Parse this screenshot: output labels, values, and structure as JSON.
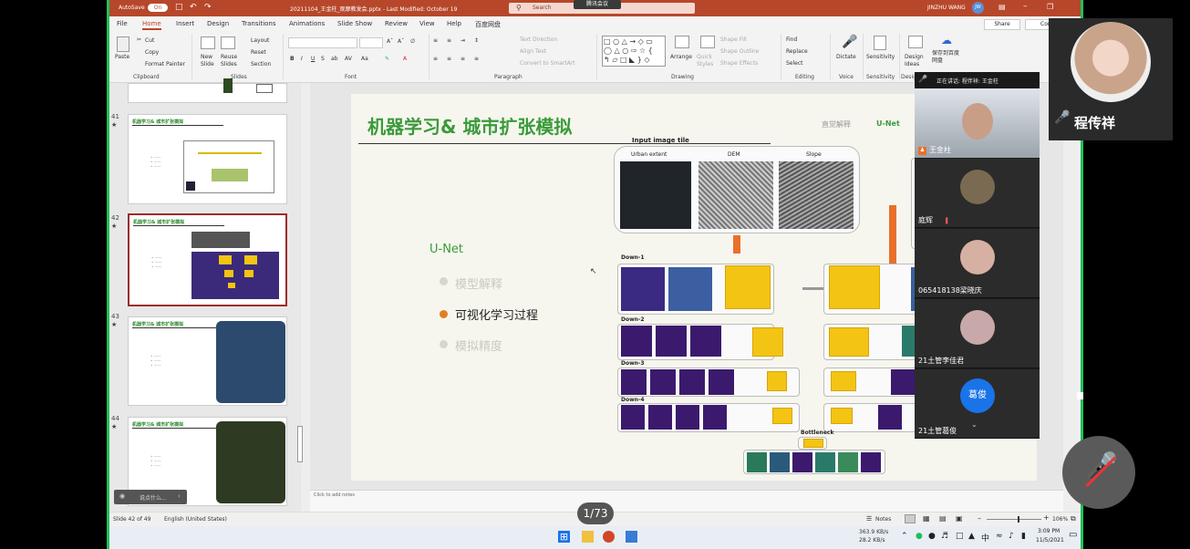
{
  "titlebar": {
    "autosave_label": "AutoSave",
    "autosave_state": "On",
    "filename": "20211104_王金柱_观摩教发会.pptx - Last Modified: October 19",
    "search_placeholder": "Search",
    "meeting_badge": "腾讯会议",
    "user": "JINZHU WANG",
    "user_initials": "JW",
    "share_label": "Share",
    "comments_label": "Con"
  },
  "tabs": [
    "File",
    "Home",
    "Insert",
    "Design",
    "Transitions",
    "Animations",
    "Slide Show",
    "Review",
    "View",
    "Help",
    "百度网盘"
  ],
  "ribbon": {
    "clipboard": {
      "paste": "Paste",
      "cut": "Cut",
      "copy": "Copy",
      "format_painter": "Format Painter",
      "label": "Clipboard"
    },
    "slides": {
      "new": "New Slide",
      "reuse": "Reuse Slides",
      "layout": "Layout",
      "reset": "Reset",
      "section": "Section",
      "label": "Slides"
    },
    "font": {
      "label": "Font",
      "buttons": [
        "B",
        "I",
        "U",
        "S",
        "ab",
        "AV",
        "Aa"
      ]
    },
    "paragraph": {
      "label": "Paragraph",
      "text_direction": "Text Direction",
      "align_text": "Align Text",
      "smartart": "Convert to SmartArt"
    },
    "drawing": {
      "label": "Drawing",
      "arrange": "Arrange",
      "quick_styles": "Quick Styles",
      "shape_fill": "Shape Fill",
      "shape_outline": "Shape Outline",
      "shape_effects": "Shape Effects"
    },
    "editing": {
      "label": "Editing",
      "find": "Find",
      "replace": "Replace",
      "select": "Select"
    },
    "voice": {
      "label": "Voice",
      "dictate": "Dictate"
    },
    "sensitivity": {
      "label": "Sensitivity",
      "button": "Sensitivity"
    },
    "designer": {
      "label": "Desig",
      "button": "Design Ideas"
    },
    "baidu": {
      "button": "保存到百度网盘"
    }
  },
  "thumbnails": [
    {
      "num": "41",
      "title": "机器学习& 城市扩张模拟"
    },
    {
      "num": "42",
      "title": "机器学习& 城市扩张模拟"
    },
    {
      "num": "43",
      "title": "机器学习& 城市扩张模拟"
    },
    {
      "num": "44",
      "title": "机器学习& 城市扩张模拟"
    }
  ],
  "slide": {
    "title": "机器学习& 城市扩张模拟",
    "nav_right": [
      "直觉解释",
      "U-Net"
    ],
    "section_title": "U-Net",
    "bullets": [
      "模型解释",
      "可视化学习过程",
      "模拟精度"
    ],
    "diagram": {
      "input_title": "Input image tile",
      "inputs": [
        "Urban extent",
        "DEM",
        "Slope"
      ],
      "levels": [
        "Down-1",
        "Down-2",
        "Down-3",
        "Down-4"
      ],
      "bottleneck": "Bottleneck"
    }
  },
  "notes_placeholder": "Click to add notes",
  "status": {
    "slide_of": "Slide 42 of 49",
    "language": "English (United States)",
    "notes": "Notes",
    "zoom": "106%"
  },
  "search_widget": "说点什么...",
  "page_counter": "1/73",
  "zoom_meeting": {
    "header": "正在讲话: 程伴祥: 王金柱",
    "participants": [
      {
        "name": "王金柱"
      },
      {
        "name": "庭辉"
      },
      {
        "name": "065418138梁晓庆"
      },
      {
        "name": "21土管李佳君"
      },
      {
        "name": "21土管葛俊",
        "avatar_text": "葛俊"
      }
    ],
    "self_name": "程传祥"
  },
  "taskbar": {
    "net_up": "363.9 KB/s",
    "net_down": "28.2 KB/s",
    "ime": "中",
    "time": "3:09 PM",
    "date": "11/5/2021"
  }
}
